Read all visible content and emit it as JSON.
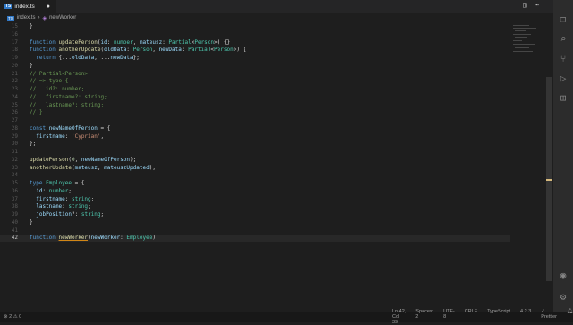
{
  "tab": {
    "label": "index.ts",
    "dirty_marker": "●",
    "icon_text": "TS"
  },
  "breadcrumb": {
    "file": "index.ts",
    "separator": "›",
    "symbol": "newWorker",
    "icon_text": "TS"
  },
  "editor": {
    "current_line": "42",
    "lines": [
      {
        "n": "15",
        "parts": [
          [
            "pn",
            "}"
          ]
        ]
      },
      {
        "n": "16",
        "parts": []
      },
      {
        "n": "17",
        "parts": [
          [
            "kw",
            "function "
          ],
          [
            "fn",
            "updatePerson"
          ],
          [
            "pn",
            "("
          ],
          [
            "var",
            "id"
          ],
          [
            "pn",
            ": "
          ],
          [
            "ty",
            "number"
          ],
          [
            "pn",
            ", "
          ],
          [
            "var",
            "mateusz"
          ],
          [
            "pn",
            ": "
          ],
          [
            "ty",
            "Partial"
          ],
          [
            "pn",
            "<"
          ],
          [
            "ty",
            "Person"
          ],
          [
            "pn",
            ">) {}"
          ]
        ]
      },
      {
        "n": "18",
        "parts": [
          [
            "kw",
            "function "
          ],
          [
            "fn",
            "anotherUpdate"
          ],
          [
            "pn",
            "("
          ],
          [
            "var",
            "oldData"
          ],
          [
            "pn",
            ": "
          ],
          [
            "ty",
            "Person"
          ],
          [
            "pn",
            ", "
          ],
          [
            "var",
            "newData"
          ],
          [
            "pn",
            ": "
          ],
          [
            "ty",
            "Partial"
          ],
          [
            "pn",
            "<"
          ],
          [
            "ty",
            "Person"
          ],
          [
            "pn",
            ">) {"
          ]
        ]
      },
      {
        "n": "19",
        "parts": [
          [
            "pn",
            "  "
          ],
          [
            "kw",
            "return"
          ],
          [
            "pn",
            " {..."
          ],
          [
            "var",
            "oldData"
          ],
          [
            "pn",
            ", ..."
          ],
          [
            "var",
            "newData"
          ],
          [
            "pn",
            "};"
          ]
        ]
      },
      {
        "n": "20",
        "parts": [
          [
            "pn",
            "}"
          ]
        ]
      },
      {
        "n": "21",
        "parts": [
          [
            "cm",
            "// Partial<Person>"
          ]
        ]
      },
      {
        "n": "22",
        "parts": [
          [
            "cm",
            "// => type {"
          ]
        ]
      },
      {
        "n": "23",
        "parts": [
          [
            "cm",
            "//   id?: number;"
          ]
        ]
      },
      {
        "n": "24",
        "parts": [
          [
            "cm",
            "//   firstname?: string;"
          ]
        ]
      },
      {
        "n": "25",
        "parts": [
          [
            "cm",
            "//   lastname?: string;"
          ]
        ]
      },
      {
        "n": "26",
        "parts": [
          [
            "cm",
            "// }"
          ]
        ]
      },
      {
        "n": "27",
        "parts": []
      },
      {
        "n": "28",
        "parts": [
          [
            "kw",
            "const "
          ],
          [
            "var",
            "newNameOfPerson"
          ],
          [
            "pn",
            " = {"
          ]
        ]
      },
      {
        "n": "29",
        "parts": [
          [
            "pn",
            "  "
          ],
          [
            "var",
            "firstname"
          ],
          [
            "pn",
            ": "
          ],
          [
            "str",
            "'Cyprian'"
          ],
          [
            "pn",
            ","
          ]
        ]
      },
      {
        "n": "30",
        "parts": [
          [
            "pn",
            "};"
          ]
        ]
      },
      {
        "n": "31",
        "parts": []
      },
      {
        "n": "32",
        "parts": [
          [
            "fn",
            "updatePerson"
          ],
          [
            "pn",
            "("
          ],
          [
            "num",
            "0"
          ],
          [
            "pn",
            ", "
          ],
          [
            "var",
            "newNameOfPerson"
          ],
          [
            "pn",
            ");"
          ]
        ]
      },
      {
        "n": "33",
        "parts": [
          [
            "fn",
            "anotherUpdate"
          ],
          [
            "pn",
            "("
          ],
          [
            "var",
            "mateusz"
          ],
          [
            "pn",
            ", "
          ],
          [
            "var",
            "mateuszUpdated"
          ],
          [
            "pn",
            ");"
          ]
        ]
      },
      {
        "n": "34",
        "parts": []
      },
      {
        "n": "35",
        "parts": [
          [
            "kw",
            "type "
          ],
          [
            "ty",
            "Employee"
          ],
          [
            "pn",
            " = {"
          ]
        ]
      },
      {
        "n": "36",
        "parts": [
          [
            "pn",
            "  "
          ],
          [
            "var",
            "id"
          ],
          [
            "pn",
            ": "
          ],
          [
            "ty",
            "number"
          ],
          [
            "pn",
            ";"
          ]
        ]
      },
      {
        "n": "37",
        "parts": [
          [
            "pn",
            "  "
          ],
          [
            "var",
            "firstname"
          ],
          [
            "pn",
            ": "
          ],
          [
            "ty",
            "string"
          ],
          [
            "pn",
            ";"
          ]
        ]
      },
      {
        "n": "38",
        "parts": [
          [
            "pn",
            "  "
          ],
          [
            "var",
            "lastname"
          ],
          [
            "pn",
            ": "
          ],
          [
            "ty",
            "string"
          ],
          [
            "pn",
            ";"
          ]
        ]
      },
      {
        "n": "39",
        "parts": [
          [
            "pn",
            "  "
          ],
          [
            "var",
            "jobPosition"
          ],
          [
            "pn",
            "?: "
          ],
          [
            "ty",
            "string"
          ],
          [
            "pn",
            ";"
          ]
        ]
      },
      {
        "n": "40",
        "parts": [
          [
            "pn",
            "}"
          ]
        ]
      },
      {
        "n": "41",
        "parts": []
      },
      {
        "n": "42",
        "parts": [
          [
            "kw",
            "function "
          ],
          [
            "fnu",
            "newWorker"
          ],
          [
            "pn",
            "("
          ],
          [
            "var",
            "newWorker"
          ],
          [
            "pn",
            ": "
          ],
          [
            "ty",
            "Employee"
          ],
          [
            "pn",
            ")"
          ]
        ]
      }
    ]
  },
  "statusbar": {
    "problems": "⊗ 2 ⚠ 0",
    "position": "Ln 42, Col 39",
    "spaces": "Spaces: 2",
    "encoding": "UTF-8",
    "eol": "CRLF",
    "language": "TypeScript",
    "version": "4.2.3",
    "prettier": "✓ Prettier"
  },
  "colors": {
    "accent": "#3178c6",
    "background": "#1e1e1e"
  }
}
